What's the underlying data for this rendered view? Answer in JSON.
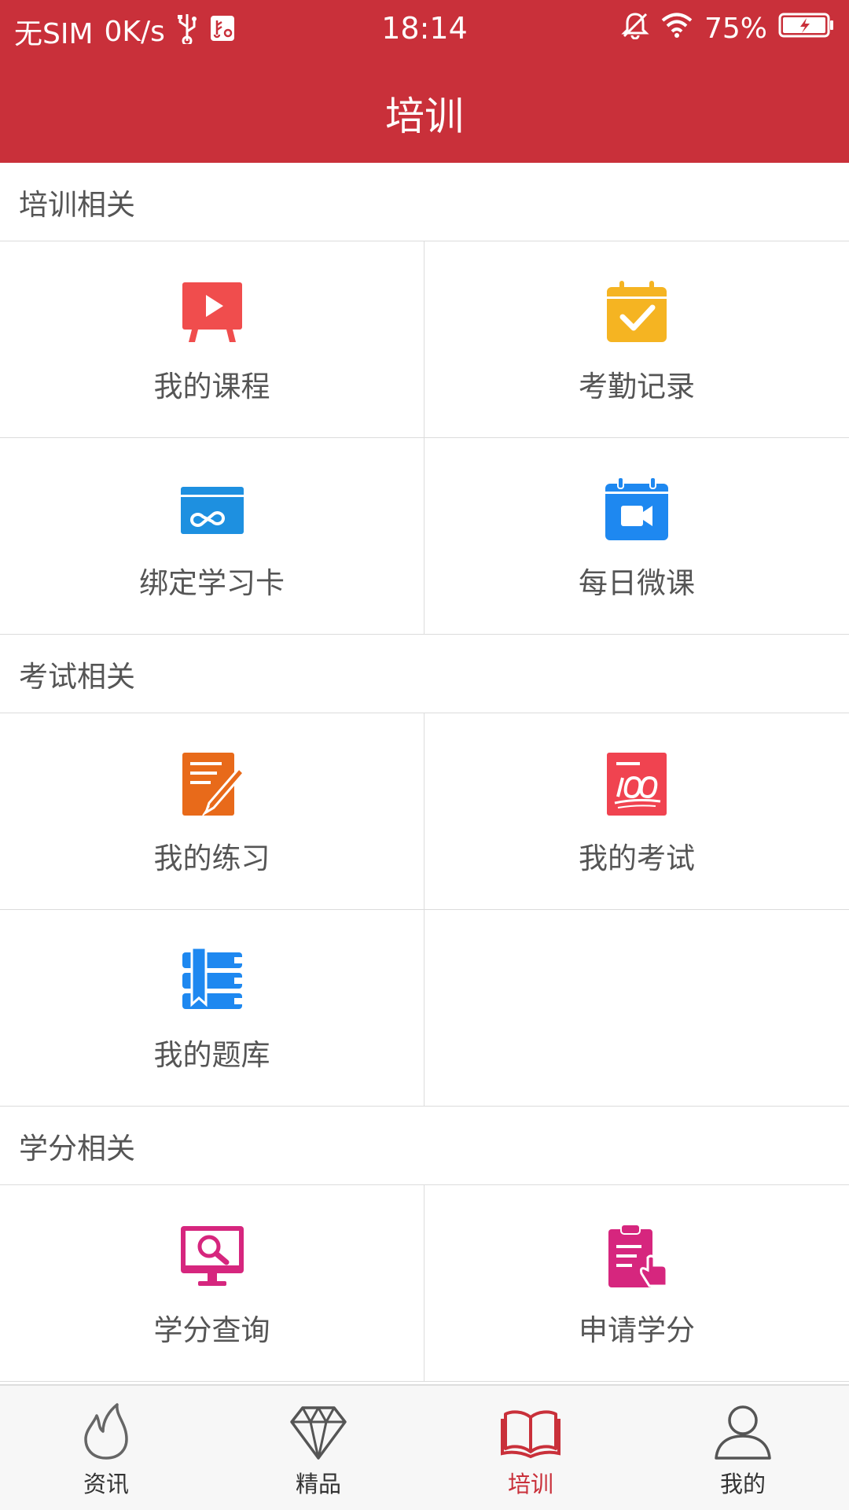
{
  "status_bar": {
    "carrier": "无SIM",
    "speed": "0K/s",
    "time": "18:14",
    "battery": "75%"
  },
  "header": {
    "title": "培训"
  },
  "sections": [
    {
      "title": "培训相关",
      "items": [
        {
          "label": "我的课程",
          "icon": "video-board-icon",
          "color": "#f04d4d"
        },
        {
          "label": "考勤记录",
          "icon": "calendar-check-icon",
          "color": "#f5b422"
        },
        {
          "label": "绑定学习卡",
          "icon": "card-infinity-icon",
          "color": "#1e90e0"
        },
        {
          "label": "每日微课",
          "icon": "calendar-video-icon",
          "color": "#1e88f0"
        }
      ]
    },
    {
      "title": "考试相关",
      "items": [
        {
          "label": "我的练习",
          "icon": "note-pen-icon",
          "color": "#e86a1a"
        },
        {
          "label": "我的考试",
          "icon": "score-100-icon",
          "color": "#f04350"
        },
        {
          "label": "我的题库",
          "icon": "book-stack-icon",
          "color": "#1e88f0"
        }
      ]
    },
    {
      "title": "学分相关",
      "items": [
        {
          "label": "学分查询",
          "icon": "monitor-search-icon",
          "color": "#d6267e"
        },
        {
          "label": "申请学分",
          "icon": "clipboard-hand-icon",
          "color": "#d6267e"
        }
      ]
    }
  ],
  "bottom_nav": {
    "active_color": "#c9303a",
    "items": [
      {
        "label": "资讯",
        "icon": "flame-icon"
      },
      {
        "label": "精品",
        "icon": "diamond-icon"
      },
      {
        "label": "培训",
        "icon": "book-open-icon",
        "active": true
      },
      {
        "label": "我的",
        "icon": "person-icon"
      }
    ]
  }
}
